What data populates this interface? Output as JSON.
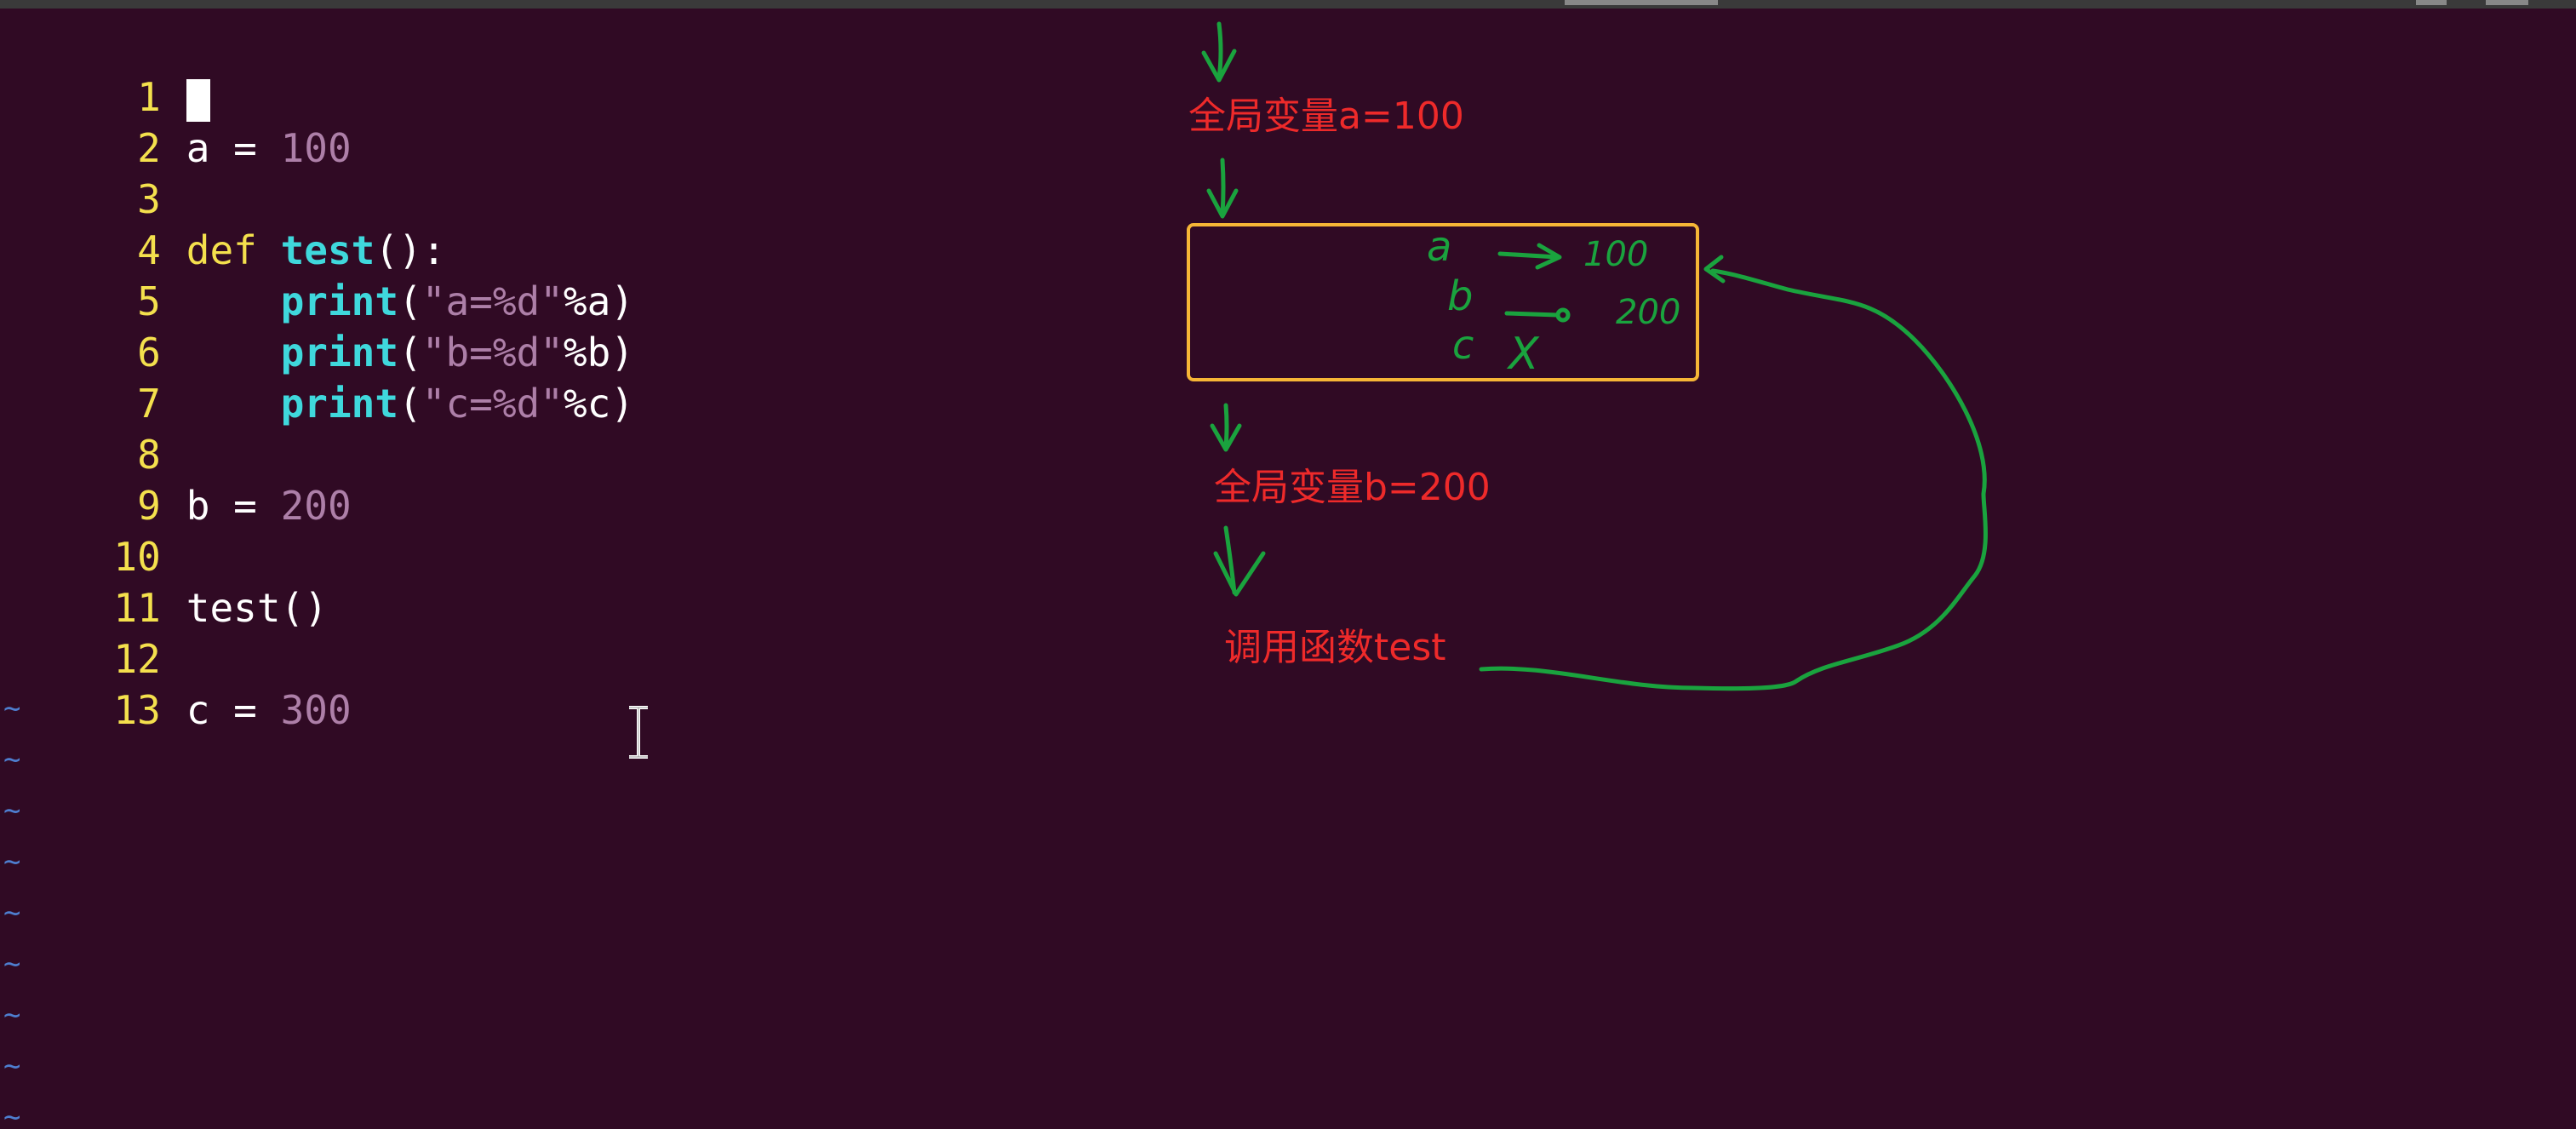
{
  "editor": {
    "lines": [
      {
        "n": "1",
        "code": ""
      },
      {
        "n": "2",
        "code": "a = 100"
      },
      {
        "n": "3",
        "code": ""
      },
      {
        "n": "4",
        "code": "def test():"
      },
      {
        "n": "5",
        "code": "    print(\"a=%d\"%a)"
      },
      {
        "n": "6",
        "code": "    print(\"b=%d\"%b)"
      },
      {
        "n": "7",
        "code": "    print(\"c=%d\"%c)"
      },
      {
        "n": "8",
        "code": ""
      },
      {
        "n": "9",
        "code": "b = 200"
      },
      {
        "n": "10",
        "code": ""
      },
      {
        "n": "11",
        "code": "test()"
      },
      {
        "n": "12",
        "code": ""
      },
      {
        "n": "13",
        "code": "c = 300"
      }
    ],
    "tilde": "~",
    "colors": {
      "background": "#300a24",
      "line_number": "#f4e04d",
      "keyword": "#f4e04d",
      "function": "#3fd8dc",
      "number": "#ad7fa8",
      "text": "#ffffff",
      "tilde": "#4e7ecf"
    }
  },
  "annotations": {
    "global_a": "全局变量a=100",
    "global_b": "全局变量b=200",
    "call_test": "调用函数test",
    "box_a_var": "a",
    "box_a_val": "100",
    "box_b_var": "b",
    "box_b_val": "200",
    "box_c_var": "c",
    "box_c_mark": "X",
    "colors": {
      "red_text": "#ee2a2a",
      "green_ink": "#1aa33e",
      "box_border": "#f6b636"
    }
  }
}
